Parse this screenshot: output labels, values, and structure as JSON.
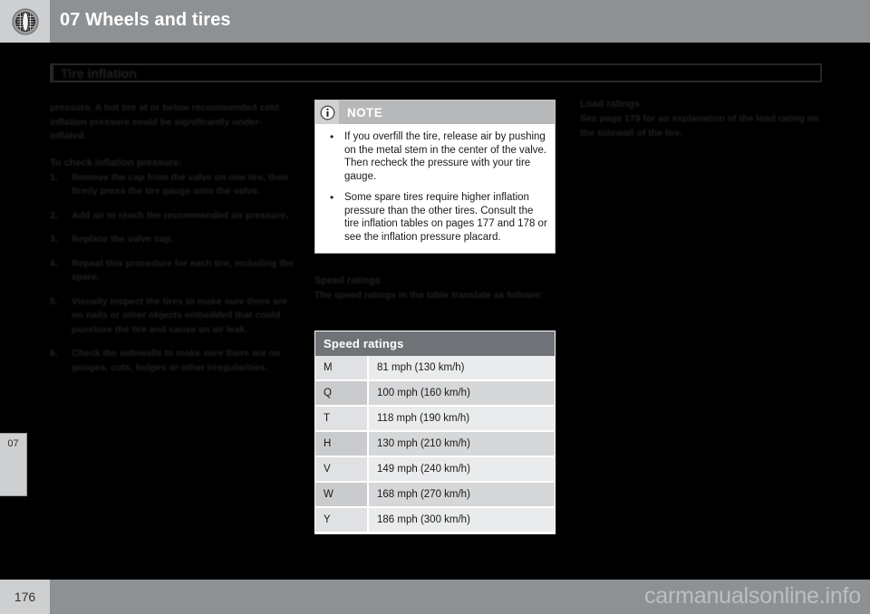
{
  "header": {
    "chapter_number": "07",
    "title": "07 Wheels and tires",
    "icon": "tire-icon"
  },
  "section": {
    "heading": "Tire inflation"
  },
  "left_column": {
    "intro_paragraph": "pressure. A hot tire at or below recommended cold inflation pressure could be significantly under-inflated.",
    "steps_heading": "To check inflation pressure:",
    "steps": [
      {
        "num": "1.",
        "text": "Remove the cap from the valve on one tire, then firmly press the tire gauge onto the valve."
      },
      {
        "num": "2.",
        "text": "Add air to reach the recommended air pressure."
      },
      {
        "num": "3.",
        "text": "Replace the valve cap."
      },
      {
        "num": "4.",
        "text": "Repeat this procedure for each tire, including the spare."
      },
      {
        "num": "5.",
        "text": "Visually inspect the tires to make sure there are no nails or other objects embedded that could puncture the tire and cause an air leak."
      },
      {
        "num": "6.",
        "text": "Check the sidewalls to make sure there are no gouges, cuts, bulges or other irregularities."
      }
    ]
  },
  "note_box": {
    "icon": "info-icon",
    "label": "NOTE",
    "bullets": [
      "If you overfill the tire, release air by pushing on the metal stem in the center of the valve. Then recheck the pressure with your tire gauge.",
      "Some spare tires require higher inflation pressure than the other tires. Consult the tire inflation tables on pages 177 and 178 or see the inflation pressure placard."
    ]
  },
  "speed_ratings": {
    "heading": "Speed ratings",
    "intro": "The speed ratings in the table translate as follows:",
    "table": {
      "header": "Speed ratings",
      "rows": [
        {
          "code": "M",
          "speed": "81 mph (130 km/h)"
        },
        {
          "code": "Q",
          "speed": "100 mph (160 km/h)"
        },
        {
          "code": "T",
          "speed": "118 mph (190 km/h)"
        },
        {
          "code": "H",
          "speed": "130 mph (210 km/h)"
        },
        {
          "code": "V",
          "speed": "149 mph (240 km/h)"
        },
        {
          "code": "W",
          "speed": "168 mph (270 km/h)"
        },
        {
          "code": "Y",
          "speed": "186 mph (300 km/h)"
        }
      ]
    }
  },
  "right_column": {
    "heading": "Load ratings",
    "body": "See page 179 for an explanation of the load rating on the sidewall of the tire."
  },
  "side_tab": {
    "label": "07"
  },
  "footer": {
    "page_number": "176",
    "watermark": "carmanualsonline.info"
  },
  "colors": {
    "page_background": "#000000",
    "header_bar": "#8e9194",
    "header_icon_block": "#cdcfd1",
    "table_header": "#6f7276",
    "note_header": "#b6b8ba",
    "text": "#1f1f1f",
    "watermark": "#bcbec0"
  }
}
